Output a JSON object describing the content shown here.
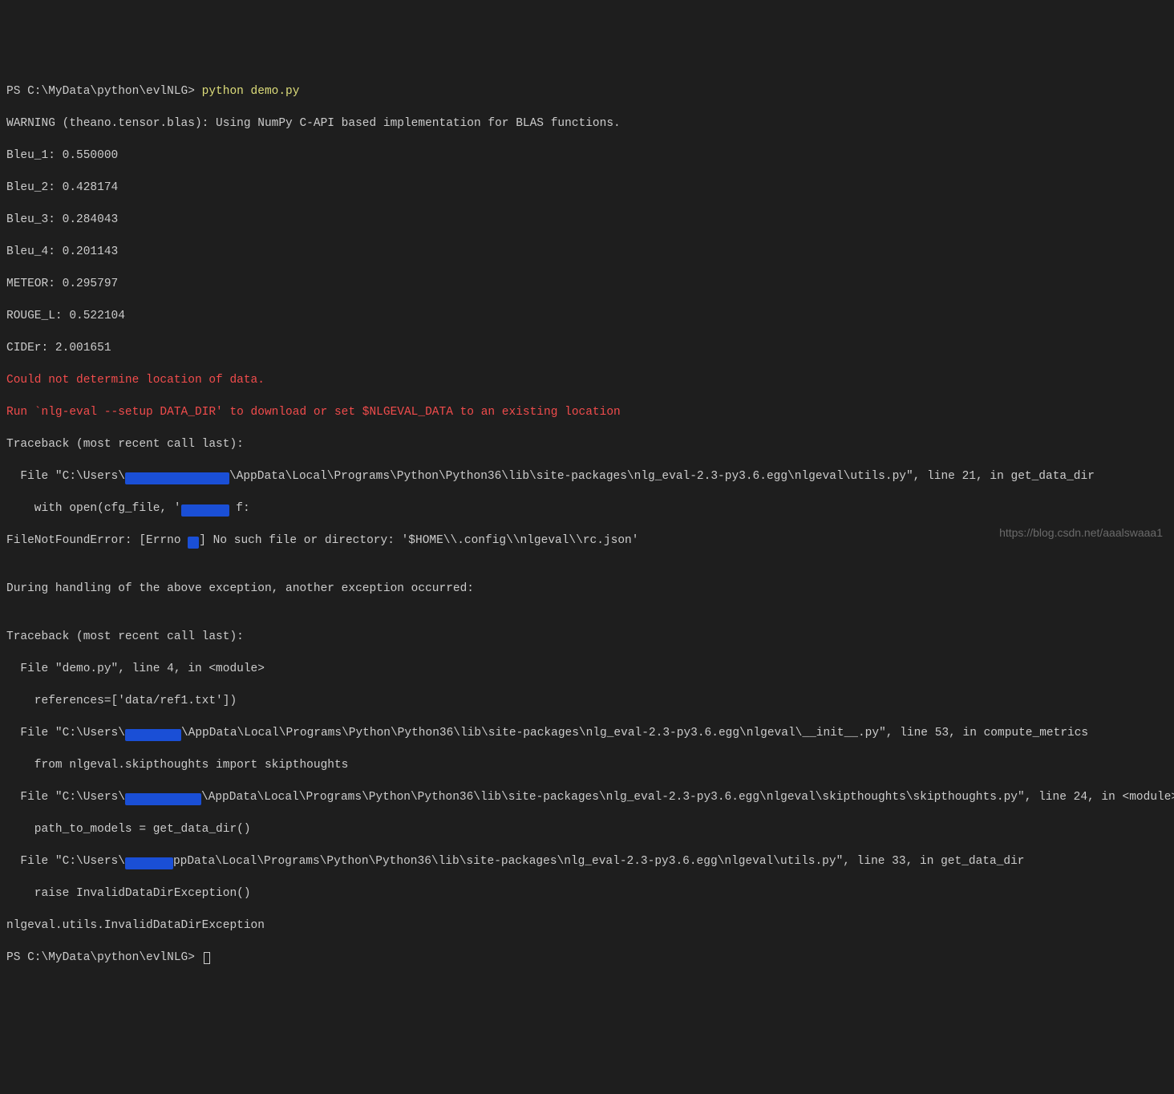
{
  "terminal": {
    "prompt1_prefix": "PS C:\\MyData\\python\\evlNLG> ",
    "command": "python demo.py",
    "warning": "WARNING (theano.tensor.blas): Using NumPy C-API based implementation for BLAS functions.",
    "bleu1": "Bleu_1: 0.550000",
    "bleu2": "Bleu_2: 0.428174",
    "bleu3": "Bleu_3: 0.284043",
    "bleu4": "Bleu_4: 0.201143",
    "meteor": "METEOR: 0.295797",
    "rouge": "ROUGE_L: 0.522104",
    "cider": "CIDEr: 2.001651",
    "err1": "Could not determine location of data.",
    "err2": "Run `nlg-eval --setup DATA_DIR' to download or set $NLGEVAL_DATA to an existing location",
    "tb1": "Traceback (most recent call last):",
    "file1a": "  File \"C:\\Users\\",
    "file1b": "\\AppData\\Local\\Programs\\Python\\Python36\\lib\\site-packages\\nlg_eval-2.3-py3.6.egg\\nlgeval\\utils.py\", line 21, in get_data_dir",
    "withopen_a": "    with open(cfg_file, 'rt') as f:",
    "fnf_a": "FileNotFoundError: [Errno 2",
    "fnf_b": "] No such file or directory: '$HOME\\\\.config\\\\nlgeval\\\\rc.json'",
    "blank": "",
    "during": "During handling of the above exception, another exception occurred:",
    "tb2": "Traceback (most recent call last):",
    "file_demo": "  File \"demo.py\", line 4, in <module>",
    "references": "    references=['data/ref1.txt'])",
    "file2a": "  File \"C:\\Users\\",
    "file2b": "\\AppData\\Local\\Programs\\Python\\Python36\\lib\\site-packages\\nlg_eval-2.3-py3.6.egg\\nlgeval\\__init__.py\", line 53, in compute_metrics",
    "from_skip": "    from nlgeval.skipthoughts import skipthoughts",
    "file3a": "  File \"C:\\Users\\",
    "file3b": "\\AppData\\Local\\Programs\\Python\\Python36\\lib\\site-packages\\nlg_eval-2.3-py3.6.egg\\nlgeval\\skipthoughts\\skipthoughts.py\", line 24, in <module>",
    "path_models": "    path_to_models = get_data_dir()",
    "file4a": "  File \"C:\\Users\\",
    "file4b": "ppData\\Local\\Programs\\Python\\Python36\\lib\\site-packages\\nlg_eval-2.3-py3.6.egg\\nlgeval\\utils.py\", line 33, in get_data_dir",
    "raise": "    raise InvalidDataDirException()",
    "exception": "nlgeval.utils.InvalidDataDirException",
    "prompt2": "PS C:\\MyData\\python\\evlNLG> "
  },
  "watermark": "https://blog.csdn.net/aaalswaaa1"
}
